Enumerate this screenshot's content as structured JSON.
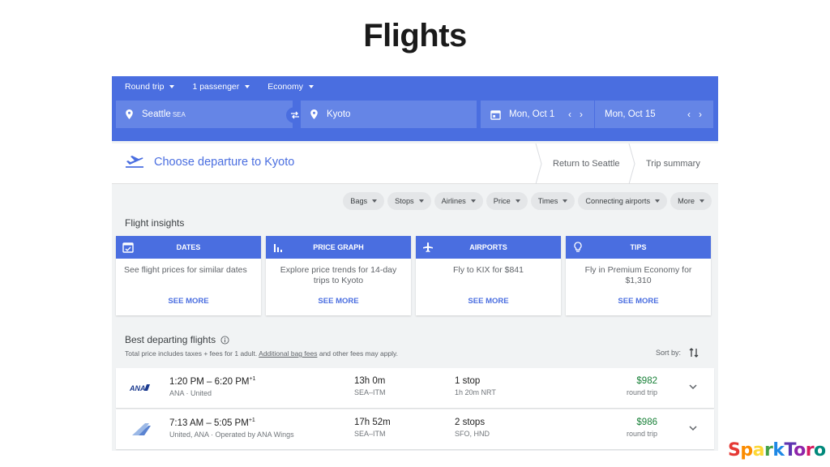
{
  "slide": {
    "title": "Flights"
  },
  "search": {
    "trip_type": "Round trip",
    "passengers": "1 passenger",
    "cabin": "Economy",
    "origin_city": "Seattle",
    "origin_code": "SEA",
    "destination": "Kyoto",
    "depart_date": "Mon, Oct 1",
    "return_date": "Mon, Oct 15"
  },
  "steps": {
    "current": "Choose departure to Kyoto",
    "return": "Return to Seattle",
    "summary": "Trip summary"
  },
  "filters": [
    "Bags",
    "Stops",
    "Airlines",
    "Price",
    "Times",
    "Connecting airports",
    "More"
  ],
  "insights": {
    "label": "Flight insights",
    "cards": [
      {
        "title": "DATES",
        "text": "See flight prices for similar dates",
        "link": "SEE MORE",
        "icon": "calendar-check-icon"
      },
      {
        "title": "PRICE GRAPH",
        "text": "Explore price trends for 14-day trips to Kyoto",
        "link": "SEE MORE",
        "icon": "bar-chart-icon"
      },
      {
        "title": "AIRPORTS",
        "text": "Fly to KIX for $841",
        "link": "SEE MORE",
        "icon": "airplane-icon"
      },
      {
        "title": "TIPS",
        "text": "Fly in Premium Economy for $1,310",
        "link": "SEE MORE",
        "icon": "lightbulb-icon"
      }
    ]
  },
  "results": {
    "label": "Best departing flights",
    "note_prefix": "Total price includes taxes + fees for 1 adult.",
    "note_link": "Additional bag fees",
    "note_suffix": "and other fees may apply.",
    "sort_label": "Sort by:",
    "flights": [
      {
        "times": "1:20 PM – 6:20 PM",
        "plus": "+1",
        "airline": "ANA · United",
        "duration": "13h 0m",
        "route": "SEA–ITM",
        "stops": "1 stop",
        "stop_detail": "1h 20m NRT",
        "price": "$982",
        "price_type": "round trip",
        "logo_text": "ANA"
      },
      {
        "times": "7:13 AM – 5:05 PM",
        "plus": "+1",
        "airline": "United, ANA · Operated by ANA Wings",
        "duration": "17h 52m",
        "route": "SEA–ITM",
        "stops": "2 stops",
        "stop_detail": "SFO, HND",
        "price": "$986",
        "price_type": "round trip"
      }
    ]
  },
  "brand": {
    "name": "SparkToro"
  },
  "colors": {
    "primary": "#4a6ee0",
    "price_green": "#188038"
  }
}
